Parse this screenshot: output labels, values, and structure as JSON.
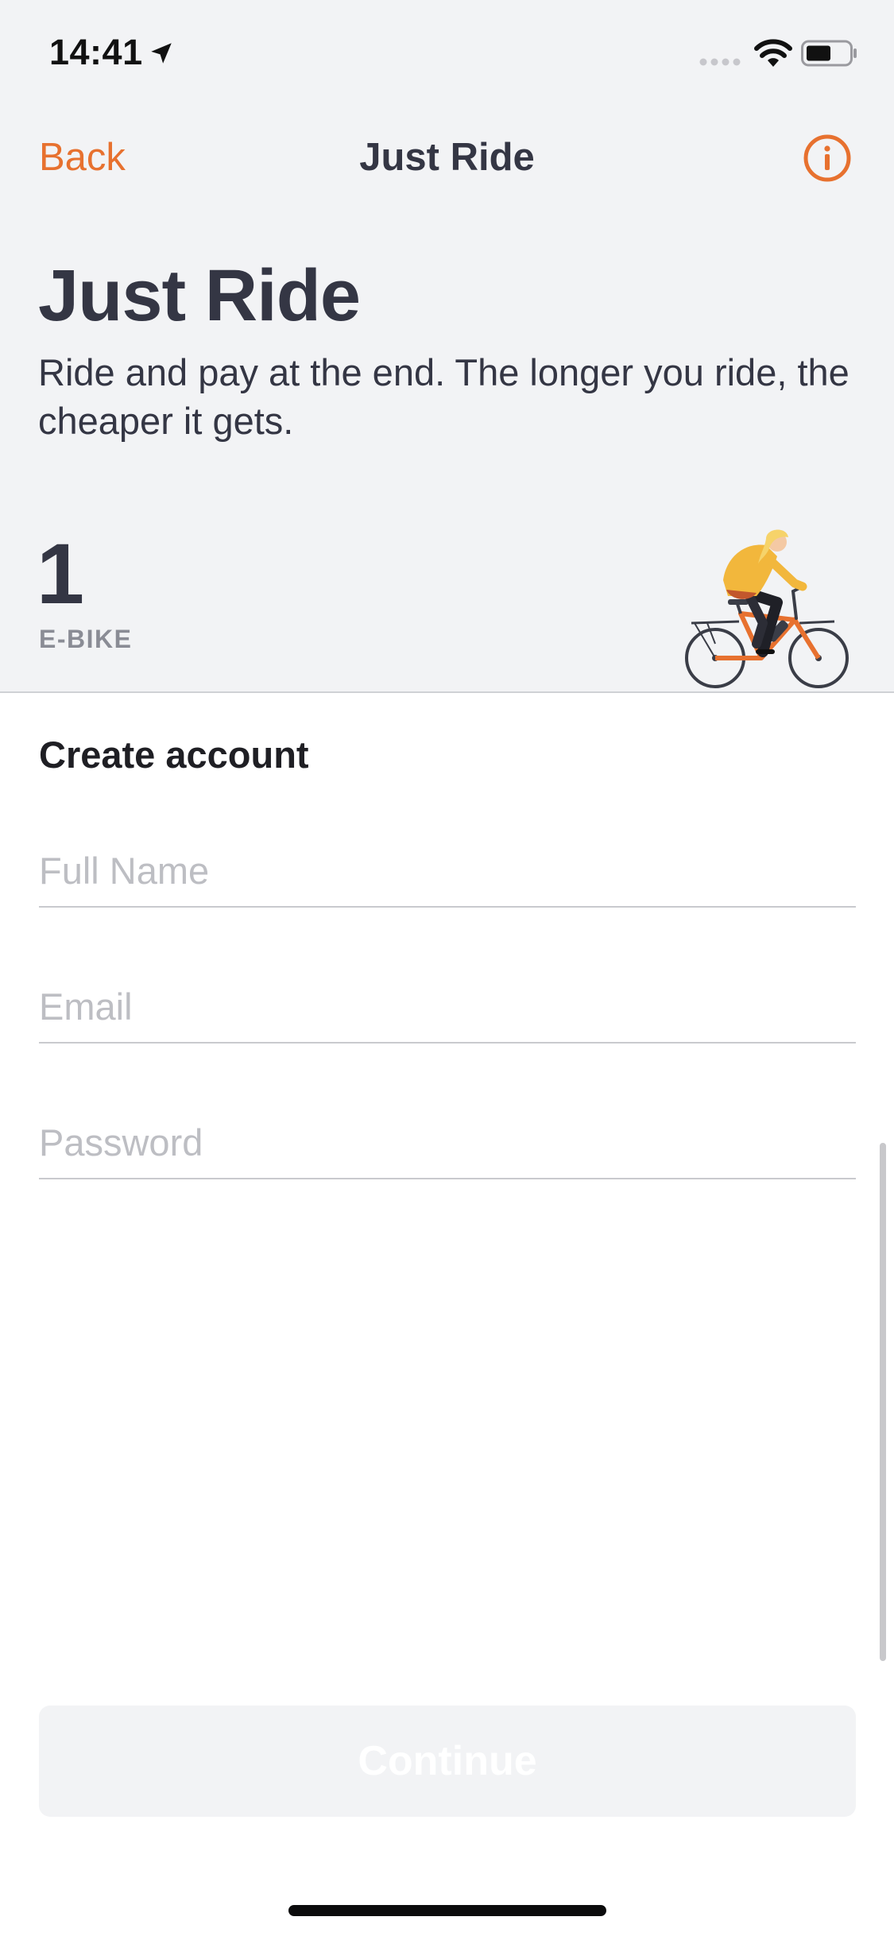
{
  "status_bar": {
    "time": "14:41"
  },
  "nav": {
    "back_label": "Back",
    "title": "Just Ride"
  },
  "header": {
    "title": "Just Ride",
    "subtitle": "Ride and pay at the end. The longer you ride, the cheaper it gets."
  },
  "vehicle": {
    "count": "1",
    "type_label": "E-BIKE"
  },
  "form": {
    "section_title": "Create account",
    "fields": [
      {
        "placeholder": "Full Name",
        "value": ""
      },
      {
        "placeholder": "Email",
        "value": ""
      },
      {
        "placeholder": "Password",
        "value": ""
      }
    ],
    "continue_label": "Continue"
  },
  "colors": {
    "accent": "#e7712f",
    "text_dark": "#343644",
    "muted": "#8a8c95",
    "header_bg": "#f2f3f5"
  },
  "icons": {
    "location": "location-arrow-icon",
    "signal": "cellular-signal-icon",
    "wifi": "wifi-icon",
    "battery": "battery-icon",
    "info": "info-circle-icon",
    "illustration": "bike-rider-illustration"
  }
}
